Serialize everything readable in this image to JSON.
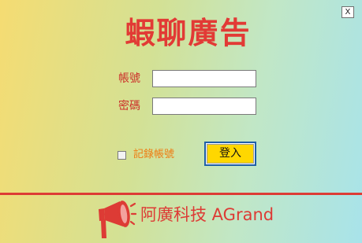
{
  "window": {
    "close_label": "X"
  },
  "header": {
    "title": "蝦聊廣告"
  },
  "login_form": {
    "account_label": "帳號",
    "account_value": "",
    "password_label": "密碼",
    "password_value": "",
    "remember_label": "記錄帳號",
    "remember_checked": false,
    "login_button_label": "登入"
  },
  "footer": {
    "logo_icon": "megaphone-icon",
    "company_name": "阿廣科技 AGrand"
  },
  "colors": {
    "accent_red": "#e23a35",
    "remember_orange": "#ef7a10",
    "login_button_bg": "#ffd700",
    "login_button_border": "#1f5fa8"
  }
}
